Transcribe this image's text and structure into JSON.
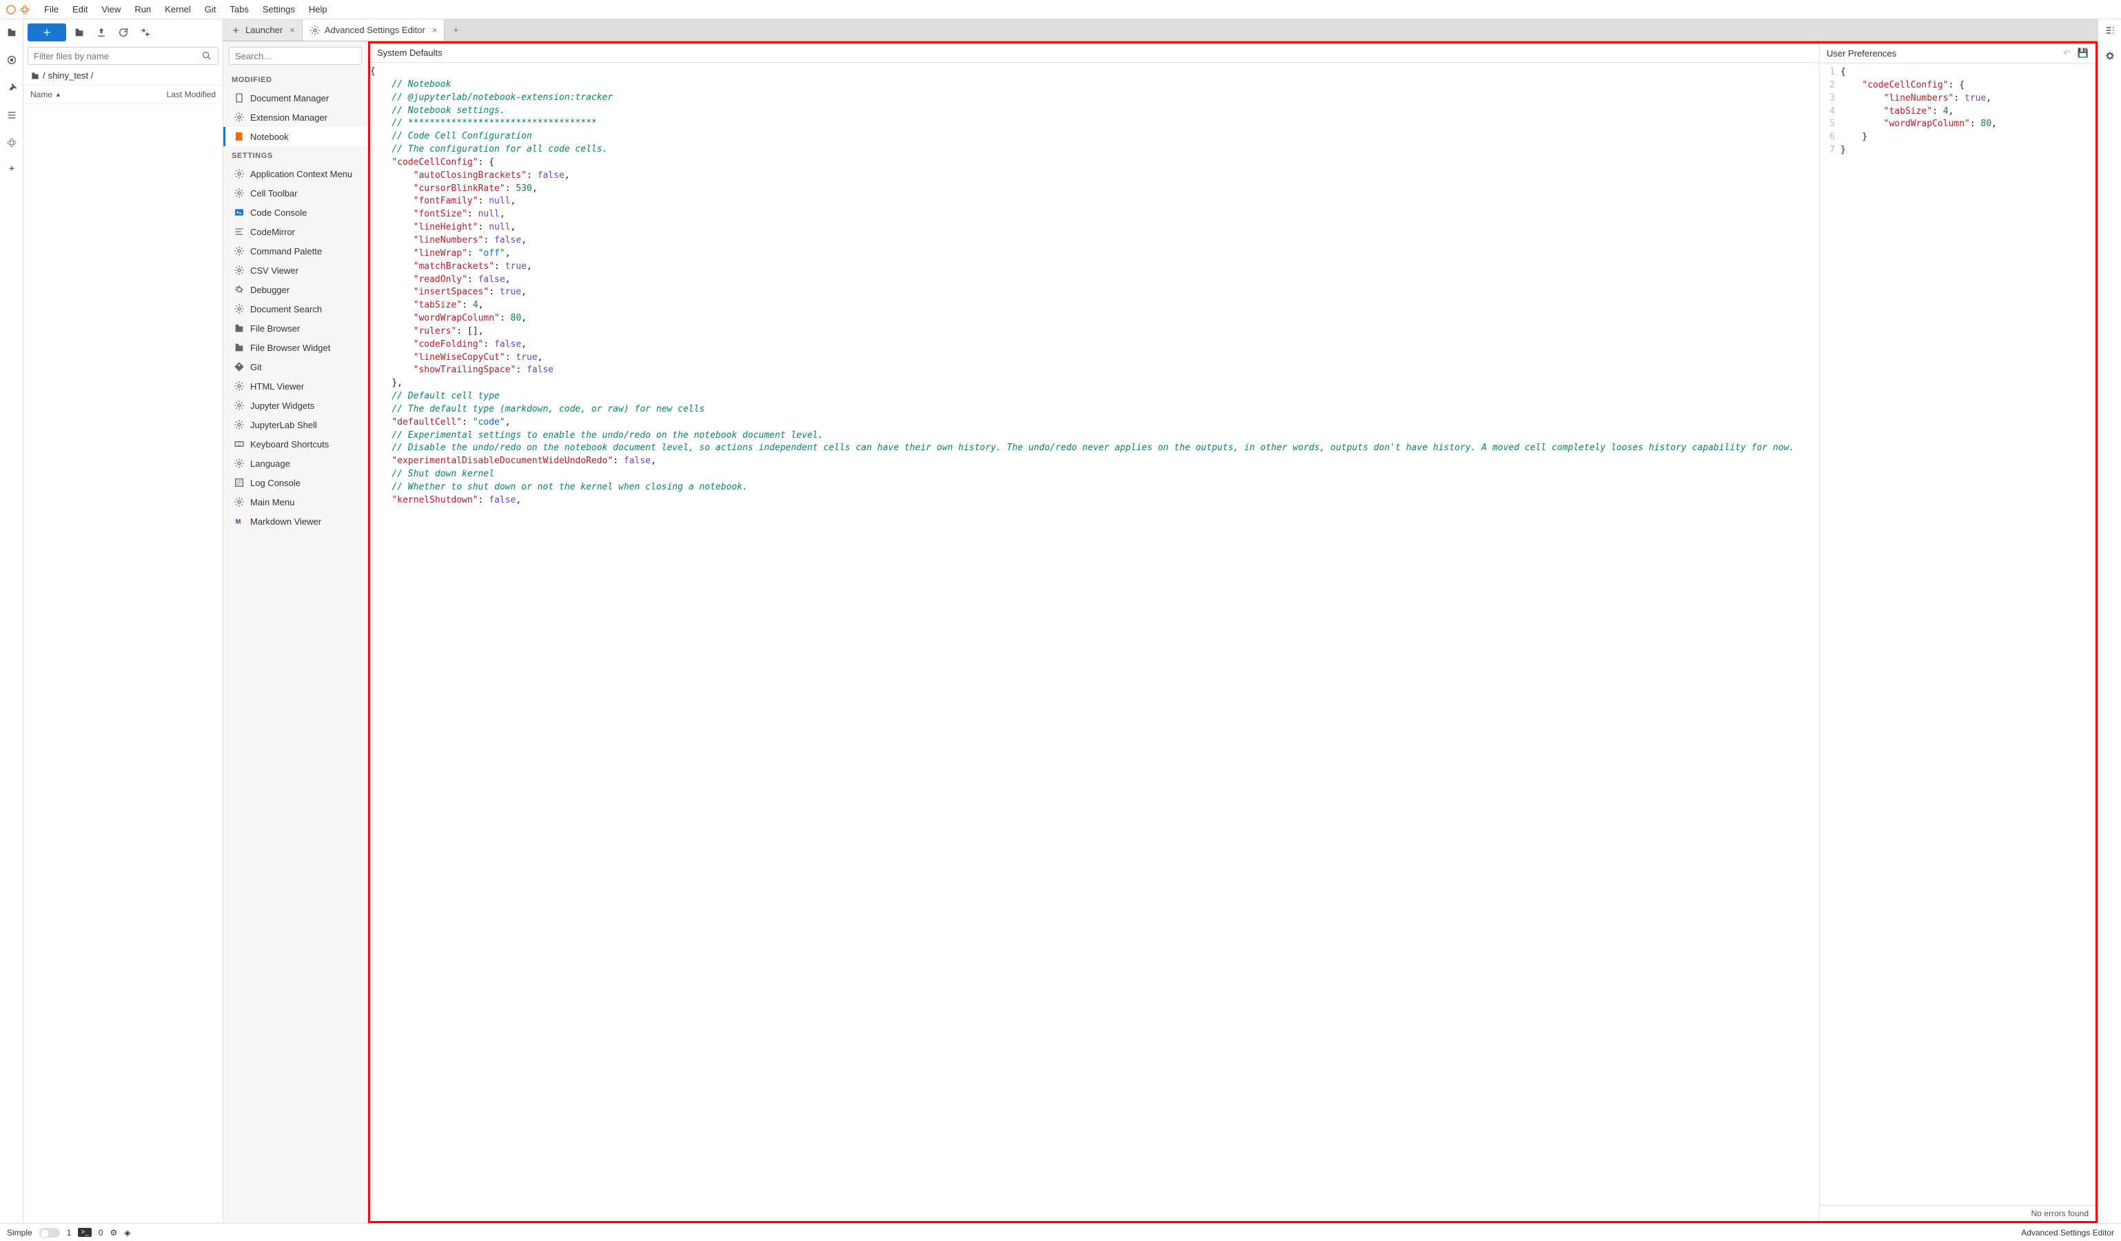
{
  "menubar": {
    "items": [
      "File",
      "Edit",
      "View",
      "Run",
      "Kernel",
      "Git",
      "Tabs",
      "Settings",
      "Help"
    ]
  },
  "filepanel": {
    "filter_placeholder": "Filter files by name",
    "breadcrumb_root": "/",
    "breadcrumb_folder": "shiny_test /",
    "col_name": "Name",
    "col_modified": "Last Modified"
  },
  "tabs": {
    "launcher": "Launcher",
    "settings": "Advanced Settings Editor"
  },
  "settings_left": {
    "search_placeholder": "Search…",
    "section_modified": "MODIFIED",
    "section_settings": "SETTINGS",
    "modified_items": [
      {
        "label": "Document Manager",
        "icon": "doc"
      },
      {
        "label": "Extension Manager",
        "icon": "gear"
      },
      {
        "label": "Notebook",
        "icon": "notebook",
        "selected": true
      }
    ],
    "settings_items": [
      {
        "label": "Application Context Menu",
        "icon": "gear"
      },
      {
        "label": "Cell Toolbar",
        "icon": "gear"
      },
      {
        "label": "Code Console",
        "icon": "console"
      },
      {
        "label": "CodeMirror",
        "icon": "lines"
      },
      {
        "label": "Command Palette",
        "icon": "gear"
      },
      {
        "label": "CSV Viewer",
        "icon": "gear"
      },
      {
        "label": "Debugger",
        "icon": "bug"
      },
      {
        "label": "Document Search",
        "icon": "gear"
      },
      {
        "label": "File Browser",
        "icon": "folder"
      },
      {
        "label": "File Browser Widget",
        "icon": "folder"
      },
      {
        "label": "Git",
        "icon": "git"
      },
      {
        "label": "HTML Viewer",
        "icon": "gear"
      },
      {
        "label": "Jupyter Widgets",
        "icon": "gear"
      },
      {
        "label": "JupyterLab Shell",
        "icon": "gear"
      },
      {
        "label": "Keyboard Shortcuts",
        "icon": "keyboard"
      },
      {
        "label": "Language",
        "icon": "gear"
      },
      {
        "label": "Log Console",
        "icon": "log"
      },
      {
        "label": "Main Menu",
        "icon": "gear"
      },
      {
        "label": "Markdown Viewer",
        "icon": "md"
      }
    ]
  },
  "editors": {
    "defaults_title": "System Defaults",
    "user_title": "User Preferences",
    "no_errors": "No errors found"
  },
  "defaults_code": {
    "comments_top": [
      "// Notebook",
      "// @jupyterlab/notebook-extension:tracker",
      "// Notebook settings.",
      "// ***********************************"
    ],
    "ccc_comment1": "// Code Cell Configuration",
    "ccc_comment2": "// The configuration for all code cells.",
    "ccc_key": "\"codeCellConfig\"",
    "ccc_entries": [
      {
        "k": "\"autoClosingBrackets\"",
        "v": "false",
        "t": "bool"
      },
      {
        "k": "\"cursorBlinkRate\"",
        "v": "530",
        "t": "num"
      },
      {
        "k": "\"fontFamily\"",
        "v": "null",
        "t": "null"
      },
      {
        "k": "\"fontSize\"",
        "v": "null",
        "t": "null"
      },
      {
        "k": "\"lineHeight\"",
        "v": "null",
        "t": "null"
      },
      {
        "k": "\"lineNumbers\"",
        "v": "false",
        "t": "bool"
      },
      {
        "k": "\"lineWrap\"",
        "v": "\"off\"",
        "t": "str"
      },
      {
        "k": "\"matchBrackets\"",
        "v": "true",
        "t": "bool"
      },
      {
        "k": "\"readOnly\"",
        "v": "false",
        "t": "bool"
      },
      {
        "k": "\"insertSpaces\"",
        "v": "true",
        "t": "bool"
      },
      {
        "k": "\"tabSize\"",
        "v": "4",
        "t": "num"
      },
      {
        "k": "\"wordWrapColumn\"",
        "v": "80",
        "t": "num"
      },
      {
        "k": "\"rulers\"",
        "v": "[]",
        "t": "punc"
      },
      {
        "k": "\"codeFolding\"",
        "v": "false",
        "t": "bool"
      },
      {
        "k": "\"lineWiseCopyCut\"",
        "v": "true",
        "t": "bool"
      },
      {
        "k": "\"showTrailingSpace\"",
        "v": "false",
        "t": "bool",
        "last": true
      }
    ],
    "defcell_c1": "// Default cell type",
    "defcell_c2": "// The default type (markdown, code, or raw) for new cells",
    "defcell_k": "\"defaultCell\"",
    "defcell_v": "\"code\"",
    "exp_c1": "// Experimental settings to enable the undo/redo on the notebook document level.",
    "exp_c2": "// Disable the undo/redo on the notebook document level, so actions independent cells can have their own history. The undo/redo never applies on the outputs, in other words, outputs don't have history. A moved cell completely looses history capability for now.",
    "exp_k": "\"experimentalDisableDocumentWideUndoRedo\"",
    "exp_v": "false",
    "ks_c1": "// Shut down kernel",
    "ks_c2": "// Whether to shut down or not the kernel when closing a notebook.",
    "ks_k": "\"kernelShutdown\"",
    "ks_v": "false"
  },
  "user_code": {
    "lines": [
      {
        "n": 1,
        "html": "{"
      },
      {
        "n": 2,
        "k": "\"codeCellConfig\"",
        "after": ": {"
      },
      {
        "n": 3,
        "k": "\"lineNumbers\"",
        "v": "true",
        "t": "bool"
      },
      {
        "n": 4,
        "k": "\"tabSize\"",
        "v": "4",
        "t": "num"
      },
      {
        "n": 5,
        "k": "\"wordWrapColumn\"",
        "v": "80",
        "t": "num",
        "last": true
      },
      {
        "n": 6,
        "html": "    }"
      },
      {
        "n": 7,
        "html": "}"
      }
    ]
  },
  "statusbar": {
    "simple": "Simple",
    "one": "1",
    "zero": "0",
    "right": "Advanced Settings Editor"
  }
}
